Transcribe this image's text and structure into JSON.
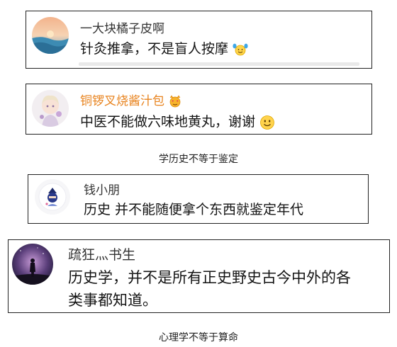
{
  "comments": [
    {
      "username": "一大块橘子皮啊",
      "text": "针灸推拿，不是盲人按摩",
      "emoji_icon": "raising-hands-emoji-icon",
      "name_color": "#333333"
    },
    {
      "username": "铜锣叉烧酱汁包",
      "badge_icon": "heart-eyes-cat-emoji-icon",
      "text": "中医不能做六味地黄丸，谢谢",
      "emoji_icon": "smile-emoji-icon",
      "name_color": "#e8831e"
    },
    {
      "username": "钱小朋",
      "text": "历史 并不能随便拿个东西就鉴定年代",
      "name_color": "#333333"
    },
    {
      "username": "疏狂灬书生",
      "text_line1": "历史学，并不是所有正史野史古今中外的各",
      "text_line2": "类事都知道。",
      "name_color": "#333333"
    }
  ],
  "captions": {
    "first": "学历史不等于鉴定",
    "second": "心理学不等于算命"
  }
}
